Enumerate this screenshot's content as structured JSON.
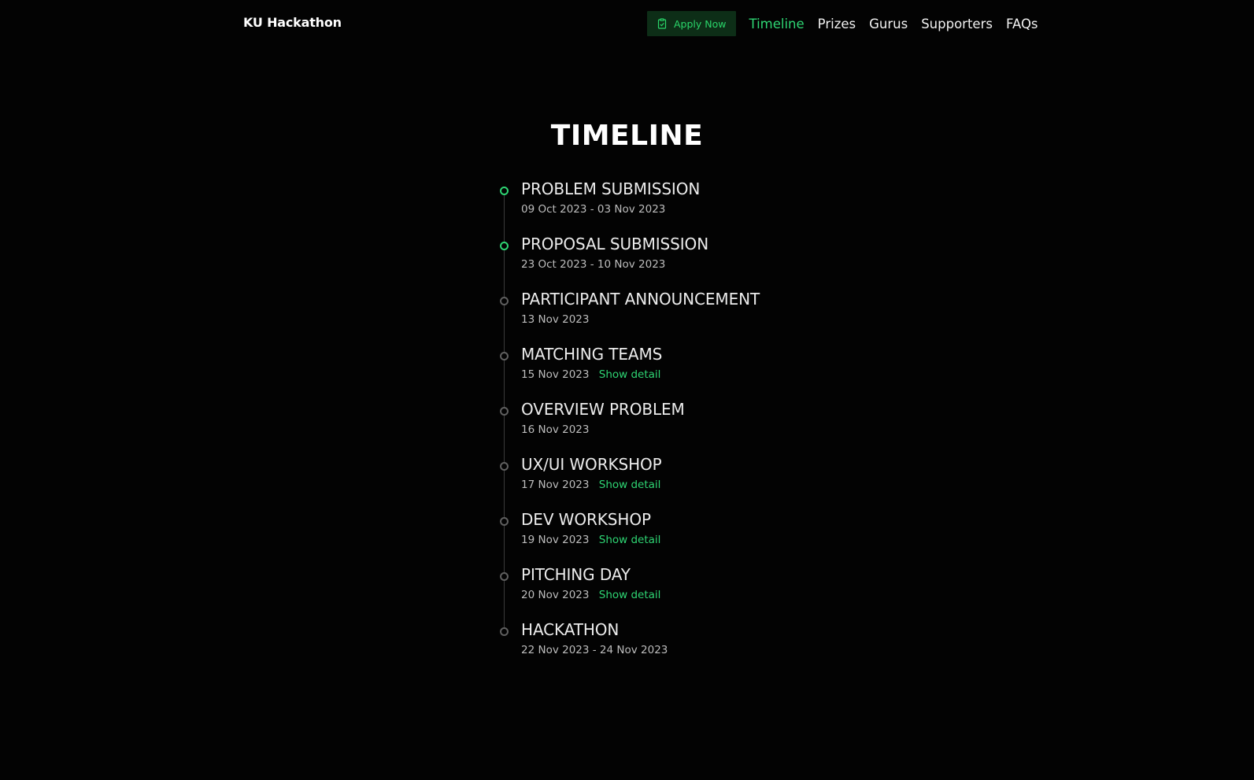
{
  "nav": {
    "brand": "KU Hackathon",
    "apply_label": "Apply Now",
    "apply_icon": "clipboard-icon",
    "links": [
      {
        "label": "Timeline",
        "active": true
      },
      {
        "label": "Prizes",
        "active": false
      },
      {
        "label": "Gurus",
        "active": false
      },
      {
        "label": "Supporters",
        "active": false
      },
      {
        "label": "FAQs",
        "active": false
      }
    ]
  },
  "page": {
    "title": "TIMELINE"
  },
  "timeline": [
    {
      "title": "PROBLEM SUBMISSION",
      "date": "09 Oct 2023 - 03 Nov 2023",
      "status": "done"
    },
    {
      "title": "PROPOSAL SUBMISSION",
      "date": "23 Oct 2023 - 10 Nov 2023",
      "status": "done"
    },
    {
      "title": "PARTICIPANT ANNOUNCEMENT",
      "date": "13 Nov 2023",
      "status": "upcoming"
    },
    {
      "title": "MATCHING TEAMS",
      "date": "15 Nov 2023",
      "status": "upcoming",
      "detail": "Show detail"
    },
    {
      "title": "OVERVIEW PROBLEM",
      "date": "16 Nov 2023",
      "status": "upcoming"
    },
    {
      "title": "UX/UI WORKSHOP",
      "date": "17 Nov 2023",
      "status": "upcoming",
      "detail": "Show detail"
    },
    {
      "title": "DEV WORKSHOP",
      "date": "19 Nov 2023",
      "status": "upcoming",
      "detail": "Show detail"
    },
    {
      "title": "PITCHING DAY",
      "date": "20 Nov 2023",
      "status": "upcoming",
      "detail": "Show detail"
    },
    {
      "title": "HACKATHON",
      "date": "22 Nov 2023 - 24 Nov 2023",
      "status": "upcoming"
    }
  ],
  "colors": {
    "background": "#030303",
    "accent": "#2ed573",
    "button_bg": "#0d2e17",
    "inactive_dot": "#5f5f5f"
  }
}
